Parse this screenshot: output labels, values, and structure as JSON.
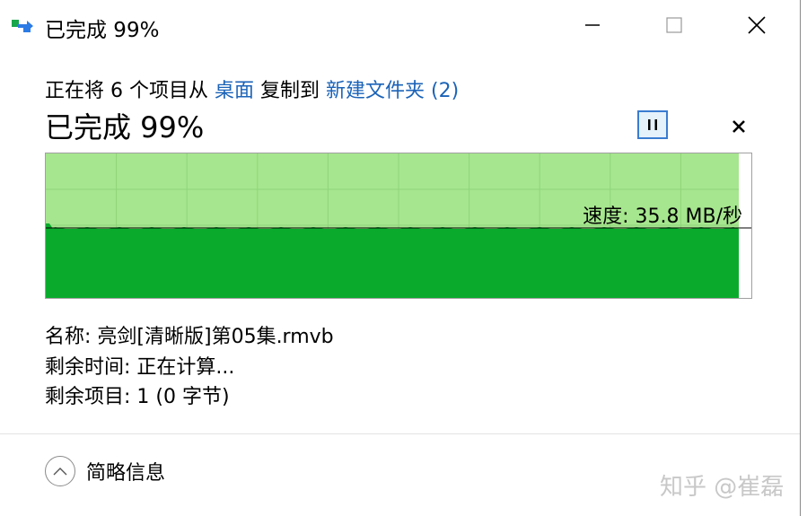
{
  "title": "已完成 99%",
  "header": {
    "prefix": "正在将 6 个项目从",
    "source": "桌面",
    "middle": "复制到",
    "destination": "新建文件夹 (2)"
  },
  "progress": {
    "label": "已完成 99%",
    "percent": 99,
    "speed_text": "速度: 35.8 MB/秒"
  },
  "details": {
    "name": "名称: 亮剑[清晰版]第05集.rmvb",
    "time_left": "剩余时间: 正在计算...",
    "items_left": "剩余项目: 1 (0 字节)"
  },
  "footer": {
    "toggle_label": "简略信息"
  },
  "watermark": "知乎 @崔磊",
  "colors": {
    "graph_fill": "#0aab2d",
    "graph_done_bg": "#a6e68e",
    "link": "#1b63b8"
  }
}
